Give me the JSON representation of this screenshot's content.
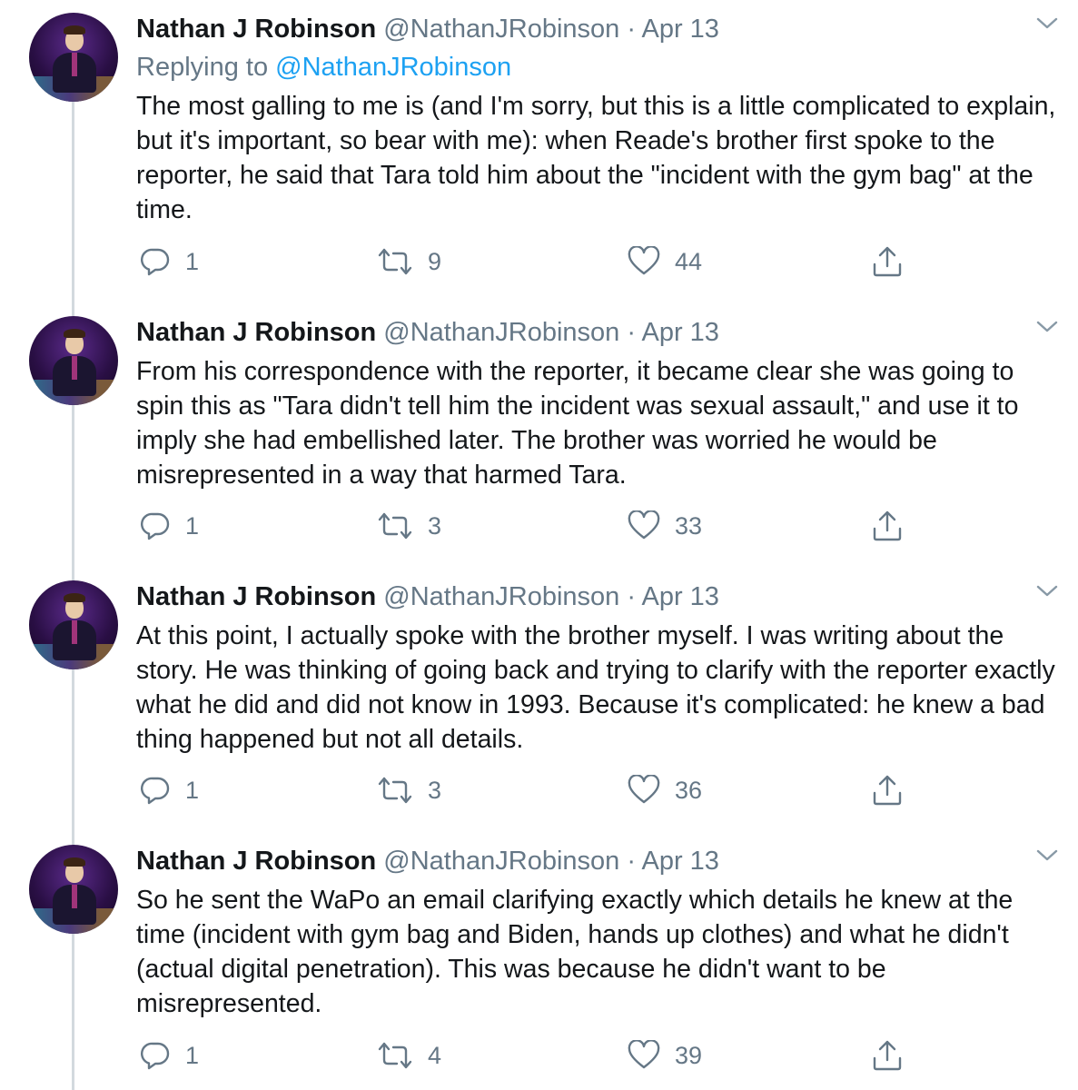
{
  "tweets": [
    {
      "name": "Nathan J Robinson",
      "handle": "@NathanJRobinson",
      "separator": "·",
      "date": "Apr 13",
      "replying_label": "Replying to",
      "replying_to": "@NathanJRobinson",
      "text": "The most galling to me is (and I'm sorry, but this is a little complicated to explain, but it's important, so bear with me): when Reade's brother first spoke to the reporter, he said that Tara told him about the \"incident with the gym bag\" at the time.",
      "replies": "1",
      "retweets": "9",
      "likes": "44"
    },
    {
      "name": "Nathan J Robinson",
      "handle": "@NathanJRobinson",
      "separator": "·",
      "date": "Apr 13",
      "text": "From his correspondence with the reporter, it became clear she was going to spin this as \"Tara didn't tell him the incident was sexual assault,\" and use it to imply she had embellished later. The brother was worried he would be misrepresented in a way that harmed Tara.",
      "replies": "1",
      "retweets": "3",
      "likes": "33"
    },
    {
      "name": "Nathan J Robinson",
      "handle": "@NathanJRobinson",
      "separator": "·",
      "date": "Apr 13",
      "text": "At this point, I actually spoke with the brother myself. I was writing about the story. He was thinking of going back and trying to clarify with the reporter exactly what he did and did not know in 1993. Because it's complicated: he knew a bad thing happened but not all details.",
      "replies": "1",
      "retweets": "3",
      "likes": "36"
    },
    {
      "name": "Nathan J Robinson",
      "handle": "@NathanJRobinson",
      "separator": "·",
      "date": "Apr 13",
      "text": "So he sent the WaPo an email clarifying exactly which details he knew at the time (incident with gym bag and Biden, hands up clothes) and what he didn't (actual digital penetration). This was because he didn't want to be misrepresented.",
      "replies": "1",
      "retweets": "4",
      "likes": "39"
    }
  ],
  "icons": {
    "reply": "reply-icon",
    "retweet": "retweet-icon",
    "like": "heart-icon",
    "share": "share-icon",
    "menu": "chevron-down-icon"
  },
  "colors": {
    "text": "#14171a",
    "secondary": "#657786",
    "link": "#1da1f2",
    "thread_line": "#d3d9de"
  }
}
